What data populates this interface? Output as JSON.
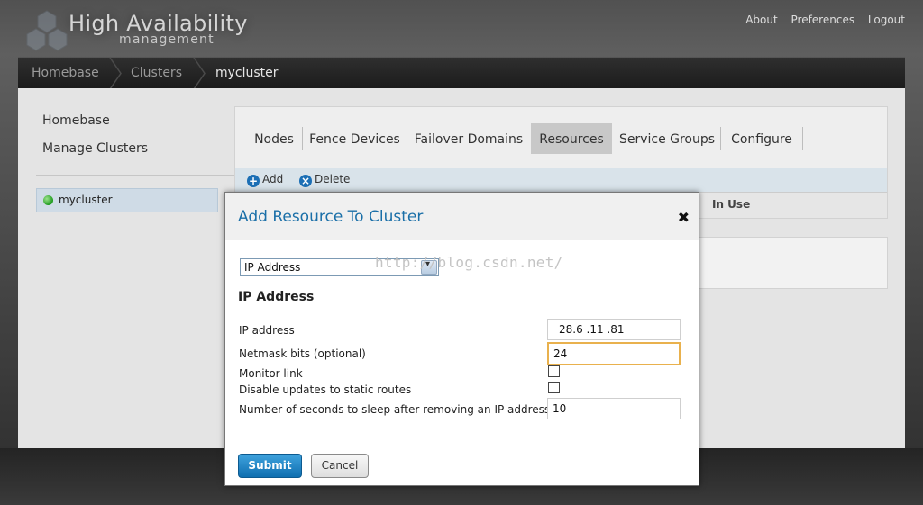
{
  "app": {
    "title_main": "High Availability",
    "title_sub": "management"
  },
  "top_links": [
    "About",
    "Preferences",
    "Logout"
  ],
  "breadcrumb": [
    "Homebase",
    "Clusters",
    "mycluster"
  ],
  "sidebar": {
    "links": [
      "Homebase",
      "Manage Clusters"
    ],
    "cluster": {
      "name": "mycluster",
      "status_color": "#1f9a1f"
    }
  },
  "tabs": [
    "Nodes",
    "Fence Devices",
    "Failover Domains",
    "Resources",
    "Service Groups",
    "Configure"
  ],
  "active_tab": "Resources",
  "actions": {
    "add": "Add",
    "delete": "Delete"
  },
  "table_header": {
    "in_use": "In Use"
  },
  "modal": {
    "title": "Add Resource To Cluster",
    "close_glyph": "✖",
    "resource_type": "IP Address",
    "section_title": "IP Address",
    "watermark": "http://blog.csdn.net/",
    "fields": {
      "ip_address": {
        "label": "IP address",
        "value": "28.6 .11 .81"
      },
      "netmask": {
        "label": "Netmask bits (optional)",
        "value": "24"
      },
      "monitor_link": {
        "label": "Monitor link",
        "checked": false
      },
      "disable_updates": {
        "label": "Disable updates to static routes",
        "checked": false
      },
      "sleep_seconds": {
        "label": "Number of seconds to sleep after removing an IP address",
        "value": "10"
      }
    },
    "submit_label": "Submit",
    "cancel_label": "Cancel"
  },
  "colors": {
    "accent": "#1a6fa8",
    "submit_button": "#1a80c4",
    "focus_border": "#e9b14d"
  }
}
